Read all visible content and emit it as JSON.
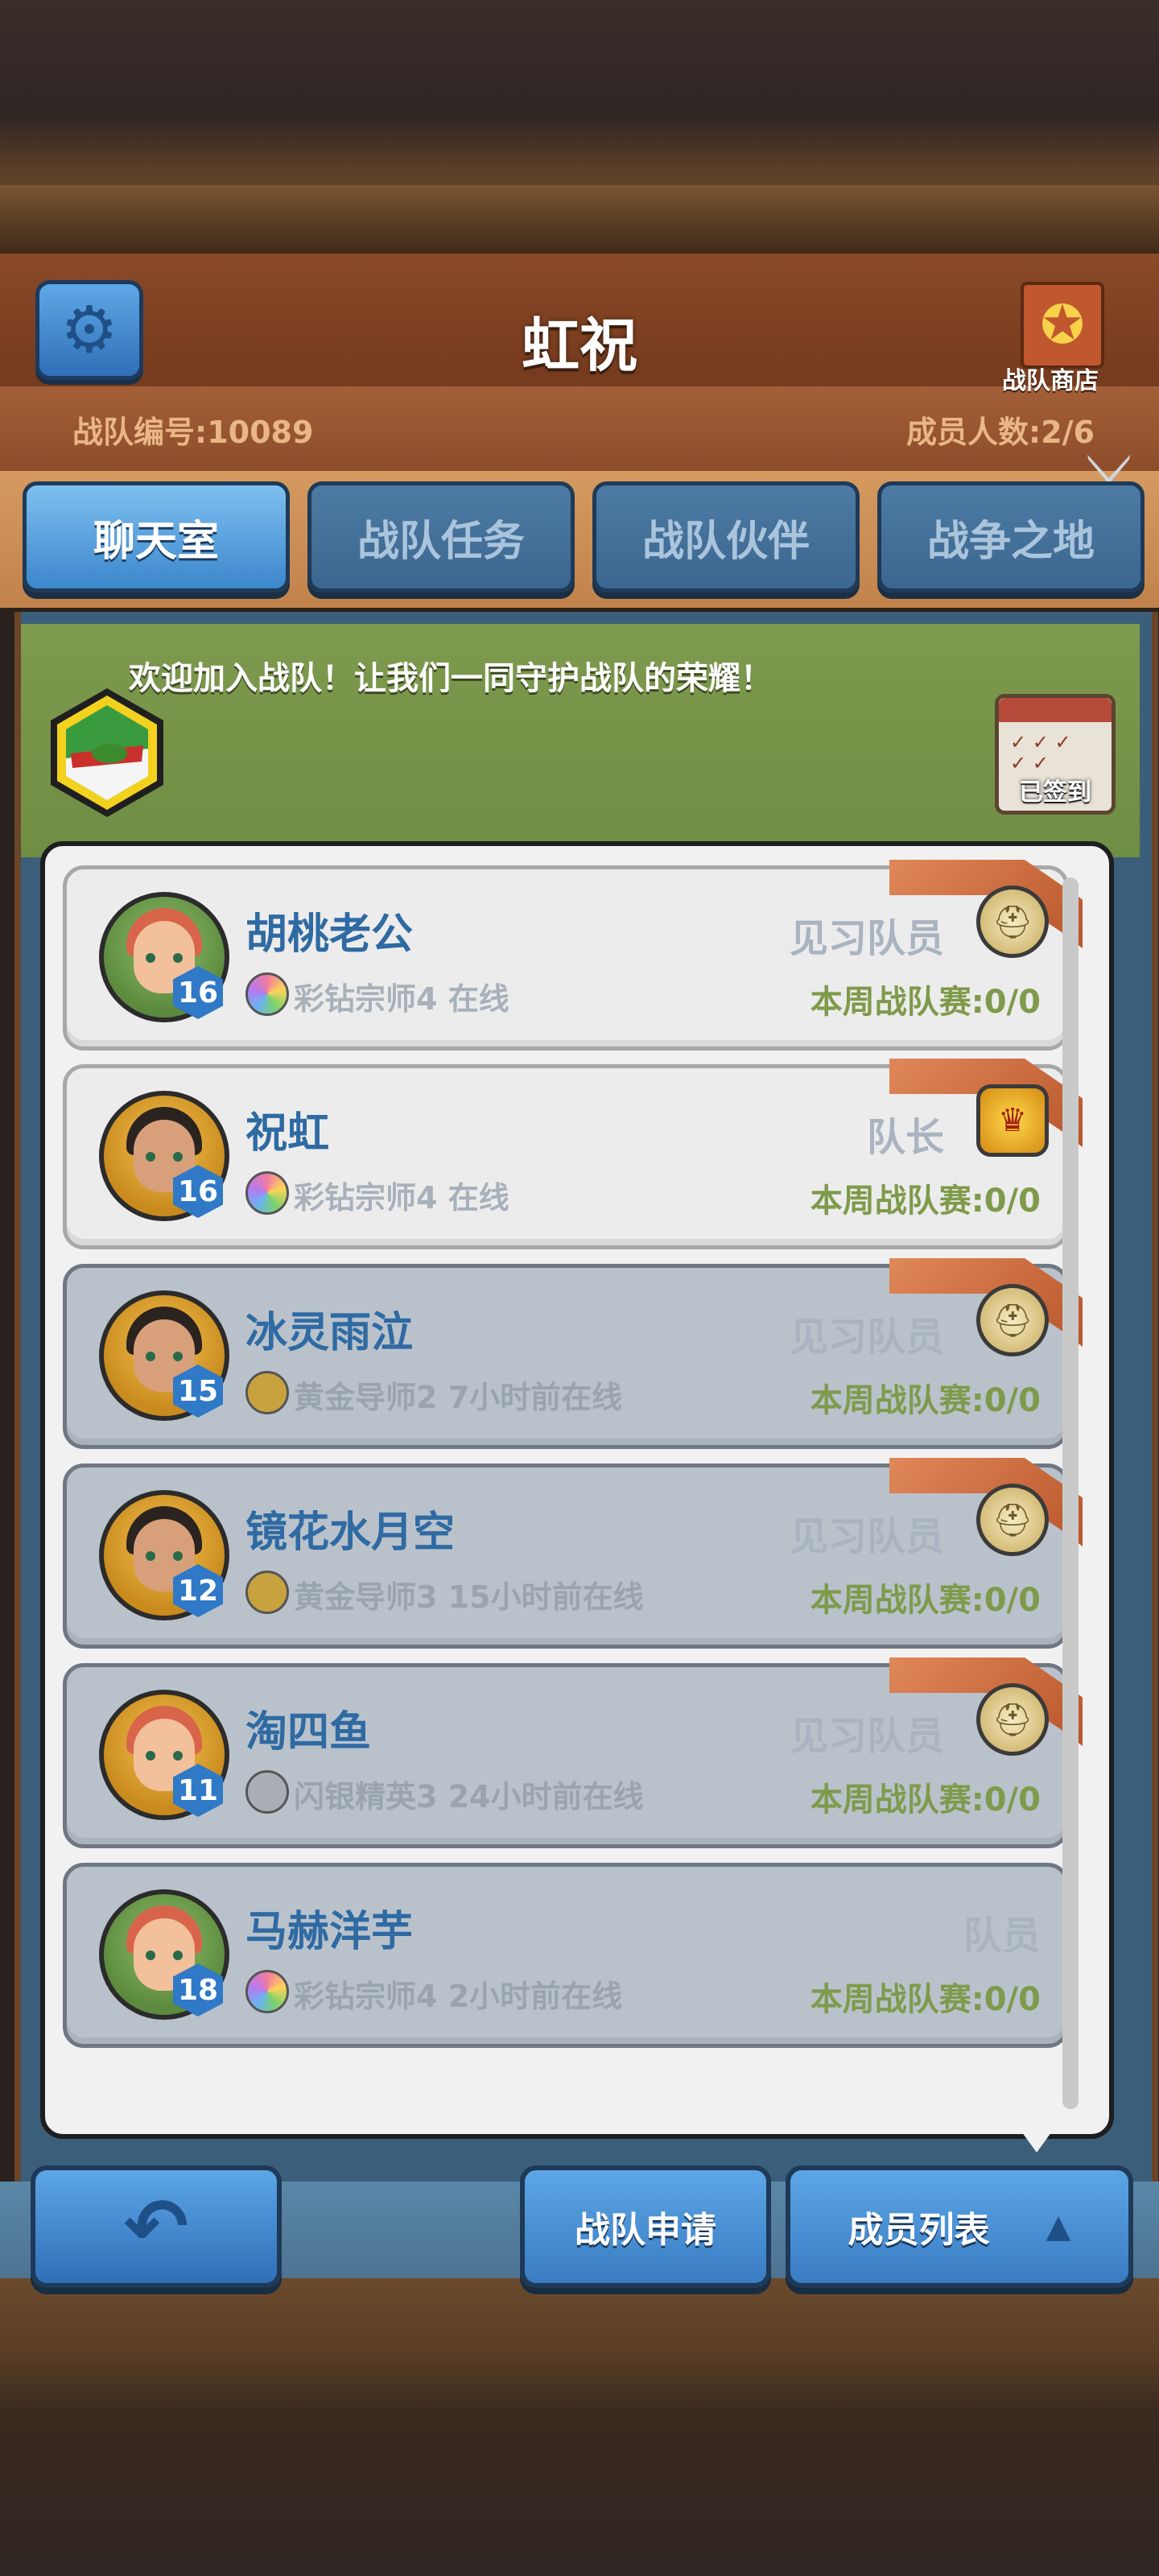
{
  "header": {
    "title": "虹祝",
    "team_number": "战队编号:10089",
    "member_count": "成员人数:2/6",
    "shop_label": "战队商店"
  },
  "tabs": [
    {
      "label": "聊天室",
      "active": true
    },
    {
      "label": "战队任务",
      "active": false
    },
    {
      "label": "战队伙伴",
      "active": false
    },
    {
      "label": "战争之地",
      "active": false
    }
  ],
  "notice": {
    "welcome": "欢迎加入战队！让我们一同守护战队的荣耀！",
    "checkin_label": "已签到"
  },
  "members": [
    {
      "name": "胡桃老公",
      "level": "16",
      "rank": "彩钻宗师4",
      "status": "在线",
      "role": "见习队员",
      "weekly": "本周战队赛:0/0",
      "online": true,
      "badge_icon": "helmet-icon"
    },
    {
      "name": "祝虹",
      "level": "16",
      "rank": "彩钻宗师4",
      "status": "在线",
      "role": "队长",
      "weekly": "本周战队赛:0/0",
      "online": true,
      "badge_icon": "crown-helmet-icon"
    },
    {
      "name": "冰灵雨泣",
      "level": "15",
      "rank": "黄金导师2",
      "status": "7小时前在线",
      "role": "见习队员",
      "weekly": "本周战队赛:0/0",
      "online": false,
      "badge_icon": "helmet-icon"
    },
    {
      "name": "镜花水月空",
      "level": "12",
      "rank": "黄金导师3",
      "status": "15小时前在线",
      "role": "见习队员",
      "weekly": "本周战队赛:0/0",
      "online": false,
      "badge_icon": "helmet-icon"
    },
    {
      "name": "淘四鱼",
      "level": "11",
      "rank": "闪银精英3",
      "status": "24小时前在线",
      "role": "见习队员",
      "weekly": "本周战队赛:0/0",
      "online": false,
      "badge_icon": "helmet-icon"
    },
    {
      "name": "马赫洋芋",
      "level": "18",
      "rank": "彩钻宗师4",
      "status": "2小时前在线",
      "role": "队员",
      "weekly": "本周战队赛:0/0",
      "online": false,
      "badge_icon": ""
    }
  ],
  "buttons": {
    "apply": "战队申请",
    "member_list": "成员列表"
  },
  "colors": {
    "accent_blue": "#3c86cc",
    "name_blue": "#2f6aa3",
    "weekly_green": "#7f9a4b"
  }
}
